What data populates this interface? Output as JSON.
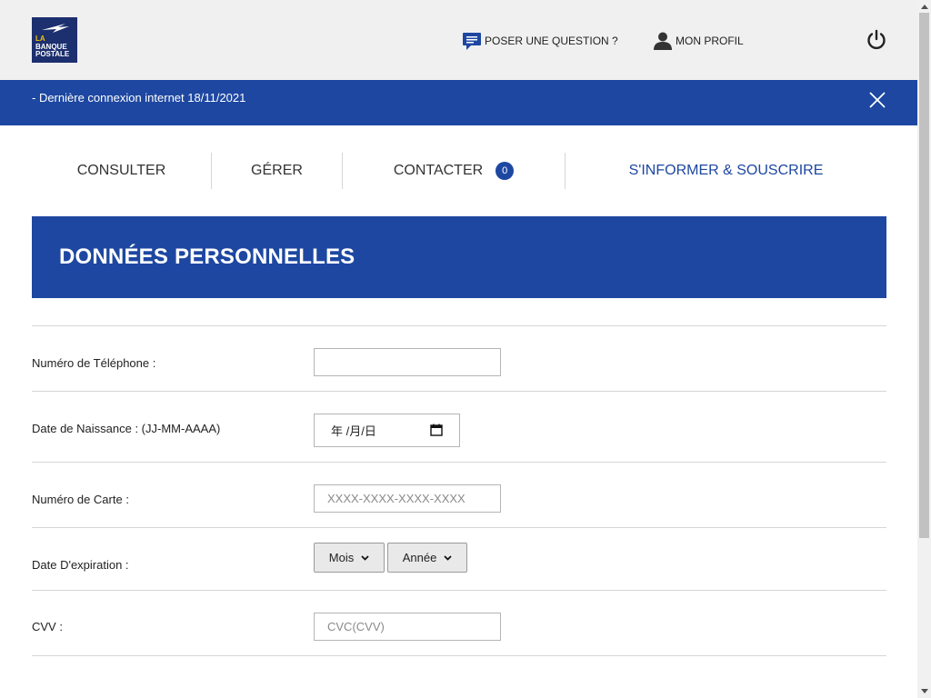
{
  "header": {
    "logo_lines": [
      "LA",
      "BANQUE",
      "POSTALE"
    ],
    "ask_question": "POSER UNE QUESTION ?",
    "profile": "MON PROFIL"
  },
  "banner": {
    "text": "- Dernière connexion internet 18/11/2021"
  },
  "nav": {
    "items": [
      {
        "label": "CONSULTER"
      },
      {
        "label": "GÉRER"
      },
      {
        "label": "CONTACTER",
        "badge": "0"
      },
      {
        "label": "S'INFORMER & SOUSCRIRE"
      }
    ]
  },
  "section": {
    "title": "DONNÉES PERSONNELLES"
  },
  "form": {
    "phone_label": "Numéro de Téléphone :",
    "phone_value": "",
    "birth_label": "Date de Naissance : (JJ-MM-AAAA)",
    "birth_value": "年 /月/日",
    "card_label": "Numéro de Carte :",
    "card_placeholder": "XXXX-XXXX-XXXX-XXXX",
    "expiry_label": "Date D'expiration :",
    "month_select": "Mois",
    "year_select": "Année",
    "cvv_label": "CVV :",
    "cvv_placeholder": "CVC(CVV)"
  },
  "colors": {
    "primary": "#1d47a1",
    "header_bg": "#f0f0f0",
    "logo_bg": "#1c2f6e"
  }
}
